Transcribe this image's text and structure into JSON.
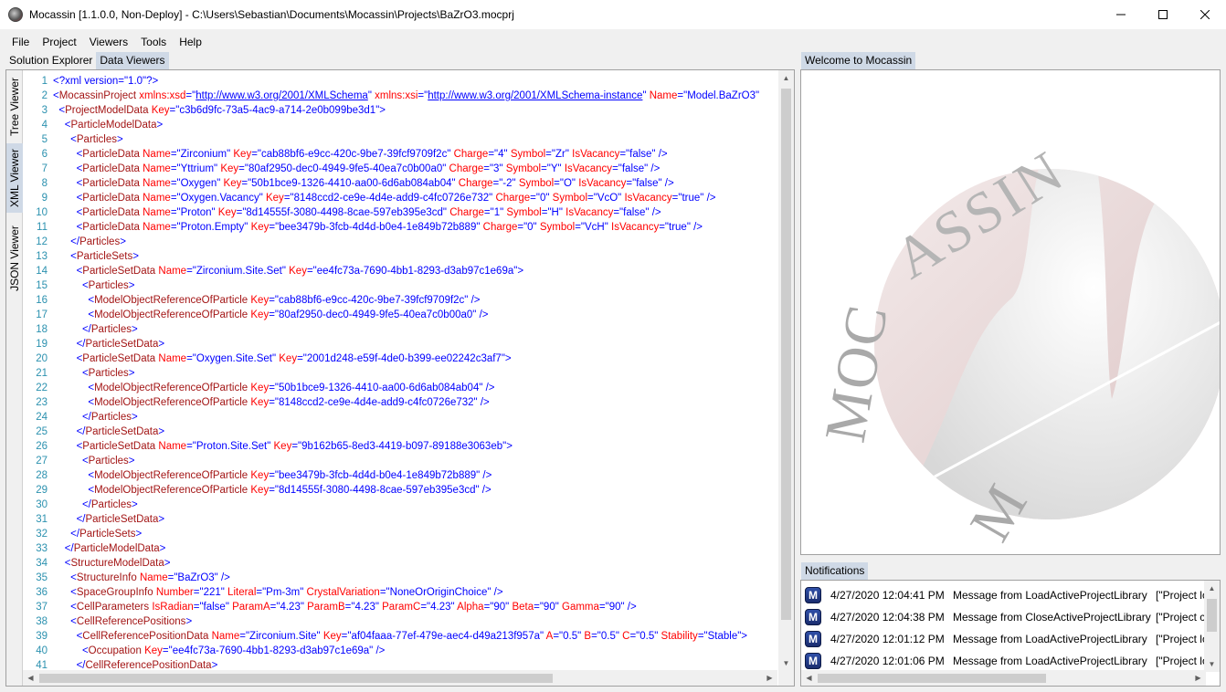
{
  "window": {
    "title": "Mocassin [1.1.0.0, Non-Deploy] - C:\\Users\\Sebastian\\Documents\\Mocassin\\Projects\\BaZrO3.mocprj",
    "minimize_icon": "minimize-icon",
    "maximize_icon": "maximize-icon",
    "close_icon": "close-icon"
  },
  "menu": [
    {
      "label": "File"
    },
    {
      "label": "Project"
    },
    {
      "label": "Viewers"
    },
    {
      "label": "Tools"
    },
    {
      "label": "Help"
    }
  ],
  "left_tabs": [
    {
      "label": "Solution Explorer",
      "active": false
    },
    {
      "label": "Data Viewers",
      "active": true
    }
  ],
  "viewer_tabs": [
    {
      "label": "Tree Viewer",
      "active": false
    },
    {
      "label": "XML Viewer",
      "active": true
    },
    {
      "label": "JSON Viewer",
      "active": false
    }
  ],
  "xml_lines": [
    {
      "n": "1",
      "html": "<span class=\"p\">&lt;?xml version=\"1.0\"?&gt;</span>"
    },
    {
      "n": "2",
      "html": "<span class=\"p\">&lt;</span><span class=\"t\">MocassinProject</span> <span class=\"a\">xmlns:xsd</span><span class=\"p\">=\"</span><span class=\"u\">http://www.w3.org/2001/XMLSchema</span><span class=\"p\">\"</span> <span class=\"a\">xmlns:xsi</span><span class=\"p\">=\"</span><span class=\"u\">http://www.w3.org/2001/XMLSchema-instance</span><span class=\"p\">\"</span> <span class=\"a\">Name</span><span class=\"p\">=\"Model.BaZrO3\"</span>"
    },
    {
      "n": "3",
      "html": "  <span class=\"p\">&lt;</span><span class=\"t\">ProjectModelData</span> <span class=\"a\">Key</span><span class=\"p\">=\"c3b6d9fc-73a5-4ac9-a714-2e0b099be3d1\"&gt;</span>"
    },
    {
      "n": "4",
      "html": "    <span class=\"p\">&lt;</span><span class=\"t\">ParticleModelData</span><span class=\"p\">&gt;</span>"
    },
    {
      "n": "5",
      "html": "      <span class=\"p\">&lt;</span><span class=\"t\">Particles</span><span class=\"p\">&gt;</span>"
    },
    {
      "n": "6",
      "html": "        <span class=\"p\">&lt;</span><span class=\"t\">ParticleData</span> <span class=\"a\">Name</span><span class=\"p\">=\"Zirconium\"</span> <span class=\"a\">Key</span><span class=\"p\">=\"cab88bf6-e9cc-420c-9be7-39fcf9709f2c\"</span> <span class=\"a\">Charge</span><span class=\"p\">=\"4\"</span> <span class=\"a\">Symbol</span><span class=\"p\">=\"Zr\"</span> <span class=\"a\">IsVacancy</span><span class=\"p\">=\"false\" /&gt;</span>"
    },
    {
      "n": "7",
      "html": "        <span class=\"p\">&lt;</span><span class=\"t\">ParticleData</span> <span class=\"a\">Name</span><span class=\"p\">=\"Yttrium\"</span> <span class=\"a\">Key</span><span class=\"p\">=\"80af2950-dec0-4949-9fe5-40ea7c0b00a0\"</span> <span class=\"a\">Charge</span><span class=\"p\">=\"3\"</span> <span class=\"a\">Symbol</span><span class=\"p\">=\"Y\"</span> <span class=\"a\">IsVacancy</span><span class=\"p\">=\"false\" /&gt;</span>"
    },
    {
      "n": "8",
      "html": "        <span class=\"p\">&lt;</span><span class=\"t\">ParticleData</span> <span class=\"a\">Name</span><span class=\"p\">=\"Oxygen\"</span> <span class=\"a\">Key</span><span class=\"p\">=\"50b1bce9-1326-4410-aa00-6d6ab084ab04\"</span> <span class=\"a\">Charge</span><span class=\"p\">=\"-2\"</span> <span class=\"a\">Symbol</span><span class=\"p\">=\"O\"</span> <span class=\"a\">IsVacancy</span><span class=\"p\">=\"false\" /&gt;</span>"
    },
    {
      "n": "9",
      "html": "        <span class=\"p\">&lt;</span><span class=\"t\">ParticleData</span> <span class=\"a\">Name</span><span class=\"p\">=\"Oxygen.Vacancy\"</span> <span class=\"a\">Key</span><span class=\"p\">=\"8148ccd2-ce9e-4d4e-add9-c4fc0726e732\"</span> <span class=\"a\">Charge</span><span class=\"p\">=\"0\"</span> <span class=\"a\">Symbol</span><span class=\"p\">=\"VcO\"</span> <span class=\"a\">IsVacancy</span><span class=\"p\">=\"true\" /&gt;</span>"
    },
    {
      "n": "10",
      "html": "        <span class=\"p\">&lt;</span><span class=\"t\">ParticleData</span> <span class=\"a\">Name</span><span class=\"p\">=\"Proton\"</span> <span class=\"a\">Key</span><span class=\"p\">=\"8d14555f-3080-4498-8cae-597eb395e3cd\"</span> <span class=\"a\">Charge</span><span class=\"p\">=\"1\"</span> <span class=\"a\">Symbol</span><span class=\"p\">=\"H\"</span> <span class=\"a\">IsVacancy</span><span class=\"p\">=\"false\" /&gt;</span>"
    },
    {
      "n": "11",
      "html": "        <span class=\"p\">&lt;</span><span class=\"t\">ParticleData</span> <span class=\"a\">Name</span><span class=\"p\">=\"Proton.Empty\"</span> <span class=\"a\">Key</span><span class=\"p\">=\"bee3479b-3fcb-4d4d-b0e4-1e849b72b889\"</span> <span class=\"a\">Charge</span><span class=\"p\">=\"0\"</span> <span class=\"a\">Symbol</span><span class=\"p\">=\"VcH\"</span> <span class=\"a\">IsVacancy</span><span class=\"p\">=\"true\" /&gt;</span>"
    },
    {
      "n": "12",
      "html": "      <span class=\"p\">&lt;/</span><span class=\"t\">Particles</span><span class=\"p\">&gt;</span>"
    },
    {
      "n": "13",
      "html": "      <span class=\"p\">&lt;</span><span class=\"t\">ParticleSets</span><span class=\"p\">&gt;</span>"
    },
    {
      "n": "14",
      "html": "        <span class=\"p\">&lt;</span><span class=\"t\">ParticleSetData</span> <span class=\"a\">Name</span><span class=\"p\">=\"Zirconium.Site.Set\"</span> <span class=\"a\">Key</span><span class=\"p\">=\"ee4fc73a-7690-4bb1-8293-d3ab97c1e69a\"&gt;</span>"
    },
    {
      "n": "15",
      "html": "          <span class=\"p\">&lt;</span><span class=\"t\">Particles</span><span class=\"p\">&gt;</span>"
    },
    {
      "n": "16",
      "html": "            <span class=\"p\">&lt;</span><span class=\"t\">ModelObjectReferenceOfParticle</span> <span class=\"a\">Key</span><span class=\"p\">=\"cab88bf6-e9cc-420c-9be7-39fcf9709f2c\" /&gt;</span>"
    },
    {
      "n": "17",
      "html": "            <span class=\"p\">&lt;</span><span class=\"t\">ModelObjectReferenceOfParticle</span> <span class=\"a\">Key</span><span class=\"p\">=\"80af2950-dec0-4949-9fe5-40ea7c0b00a0\" /&gt;</span>"
    },
    {
      "n": "18",
      "html": "          <span class=\"p\">&lt;/</span><span class=\"t\">Particles</span><span class=\"p\">&gt;</span>"
    },
    {
      "n": "19",
      "html": "        <span class=\"p\">&lt;/</span><span class=\"t\">ParticleSetData</span><span class=\"p\">&gt;</span>"
    },
    {
      "n": "20",
      "html": "        <span class=\"p\">&lt;</span><span class=\"t\">ParticleSetData</span> <span class=\"a\">Name</span><span class=\"p\">=\"Oxygen.Site.Set\"</span> <span class=\"a\">Key</span><span class=\"p\">=\"2001d248-e59f-4de0-b399-ee02242c3af7\"&gt;</span>"
    },
    {
      "n": "21",
      "html": "          <span class=\"p\">&lt;</span><span class=\"t\">Particles</span><span class=\"p\">&gt;</span>"
    },
    {
      "n": "22",
      "html": "            <span class=\"p\">&lt;</span><span class=\"t\">ModelObjectReferenceOfParticle</span> <span class=\"a\">Key</span><span class=\"p\">=\"50b1bce9-1326-4410-aa00-6d6ab084ab04\" /&gt;</span>"
    },
    {
      "n": "23",
      "html": "            <span class=\"p\">&lt;</span><span class=\"t\">ModelObjectReferenceOfParticle</span> <span class=\"a\">Key</span><span class=\"p\">=\"8148ccd2-ce9e-4d4e-add9-c4fc0726e732\" /&gt;</span>"
    },
    {
      "n": "24",
      "html": "          <span class=\"p\">&lt;/</span><span class=\"t\">Particles</span><span class=\"p\">&gt;</span>"
    },
    {
      "n": "25",
      "html": "        <span class=\"p\">&lt;/</span><span class=\"t\">ParticleSetData</span><span class=\"p\">&gt;</span>"
    },
    {
      "n": "26",
      "html": "        <span class=\"p\">&lt;</span><span class=\"t\">ParticleSetData</span> <span class=\"a\">Name</span><span class=\"p\">=\"Proton.Site.Set\"</span> <span class=\"a\">Key</span><span class=\"p\">=\"9b162b65-8ed3-4419-b097-89188e3063eb\"&gt;</span>"
    },
    {
      "n": "27",
      "html": "          <span class=\"p\">&lt;</span><span class=\"t\">Particles</span><span class=\"p\">&gt;</span>"
    },
    {
      "n": "28",
      "html": "            <span class=\"p\">&lt;</span><span class=\"t\">ModelObjectReferenceOfParticle</span> <span class=\"a\">Key</span><span class=\"p\">=\"bee3479b-3fcb-4d4d-b0e4-1e849b72b889\" /&gt;</span>"
    },
    {
      "n": "29",
      "html": "            <span class=\"p\">&lt;</span><span class=\"t\">ModelObjectReferenceOfParticle</span> <span class=\"a\">Key</span><span class=\"p\">=\"8d14555f-3080-4498-8cae-597eb395e3cd\" /&gt;</span>"
    },
    {
      "n": "30",
      "html": "          <span class=\"p\">&lt;/</span><span class=\"t\">Particles</span><span class=\"p\">&gt;</span>"
    },
    {
      "n": "31",
      "html": "        <span class=\"p\">&lt;/</span><span class=\"t\">ParticleSetData</span><span class=\"p\">&gt;</span>"
    },
    {
      "n": "32",
      "html": "      <span class=\"p\">&lt;/</span><span class=\"t\">ParticleSets</span><span class=\"p\">&gt;</span>"
    },
    {
      "n": "33",
      "html": "    <span class=\"p\">&lt;/</span><span class=\"t\">ParticleModelData</span><span class=\"p\">&gt;</span>"
    },
    {
      "n": "34",
      "html": "    <span class=\"p\">&lt;</span><span class=\"t\">StructureModelData</span><span class=\"p\">&gt;</span>"
    },
    {
      "n": "35",
      "html": "      <span class=\"p\">&lt;</span><span class=\"t\">StructureInfo</span> <span class=\"a\">Name</span><span class=\"p\">=\"BaZrO3\" /&gt;</span>"
    },
    {
      "n": "36",
      "html": "      <span class=\"p\">&lt;</span><span class=\"t\">SpaceGroupInfo</span> <span class=\"a\">Number</span><span class=\"p\">=\"221\"</span> <span class=\"a\">Literal</span><span class=\"p\">=\"Pm-3m\"</span> <span class=\"a\">CrystalVariation</span><span class=\"p\">=\"NoneOrOriginChoice\" /&gt;</span>"
    },
    {
      "n": "37",
      "html": "      <span class=\"p\">&lt;</span><span class=\"t\">CellParameters</span> <span class=\"a\">IsRadian</span><span class=\"p\">=\"false\"</span> <span class=\"a\">ParamA</span><span class=\"p\">=\"4.23\"</span> <span class=\"a\">ParamB</span><span class=\"p\">=\"4.23\"</span> <span class=\"a\">ParamC</span><span class=\"p\">=\"4.23\"</span> <span class=\"a\">Alpha</span><span class=\"p\">=\"90\"</span> <span class=\"a\">Beta</span><span class=\"p\">=\"90\"</span> <span class=\"a\">Gamma</span><span class=\"p\">=\"90\" /&gt;</span>"
    },
    {
      "n": "38",
      "html": "      <span class=\"p\">&lt;</span><span class=\"t\">CellReferencePositions</span><span class=\"p\">&gt;</span>"
    },
    {
      "n": "39",
      "html": "        <span class=\"p\">&lt;</span><span class=\"t\">CellReferencePositionData</span> <span class=\"a\">Name</span><span class=\"p\">=\"Zirconium.Site\"</span> <span class=\"a\">Key</span><span class=\"p\">=\"af04faaa-77ef-479e-aec4-d49a213f957a\"</span> <span class=\"a\">A</span><span class=\"p\">=\"0.5\"</span> <span class=\"a\">B</span><span class=\"p\">=\"0.5\"</span> <span class=\"a\">C</span><span class=\"p\">=\"0.5\"</span> <span class=\"a\">Stability</span><span class=\"p\">=\"Stable\"&gt;</span>"
    },
    {
      "n": "40",
      "html": "          <span class=\"p\">&lt;</span><span class=\"t\">Occupation</span> <span class=\"a\">Key</span><span class=\"p\">=\"ee4fc73a-7690-4bb1-8293-d3ab97c1e69a\" /&gt;</span>"
    },
    {
      "n": "41",
      "html": "        <span class=\"p\">&lt;/</span><span class=\"t\">CellReferencePositionData</span><span class=\"p\">&gt;</span>"
    }
  ],
  "welcome": {
    "tab_label": "Welcome to Mocassin",
    "logo_text": "MOCASSIN"
  },
  "notifications": {
    "tab_label": "Notifications",
    "items": [
      {
        "icon": "M",
        "time": "4/27/2020 12:04:41 PM",
        "message": "Message from LoadActiveProjectLibrary",
        "detail": "[\"Project lo"
      },
      {
        "icon": "M",
        "time": "4/27/2020 12:04:38 PM",
        "message": "Message from CloseActiveProjectLibrary",
        "detail": "[\"Project c"
      },
      {
        "icon": "M",
        "time": "4/27/2020 12:01:12 PM",
        "message": "Message from LoadActiveProjectLibrary",
        "detail": "[\"Project lo"
      },
      {
        "icon": "M",
        "time": "4/27/2020 12:01:06 PM",
        "message": "Message from LoadActiveProjectLibrary",
        "detail": "[\"Project lo"
      }
    ]
  },
  "colors": {
    "tab_active": "#cfd9e6",
    "xml_tag": "#a31515",
    "xml_attr": "#ff0000",
    "xml_value": "#0000ff",
    "line_number": "#2b91af"
  }
}
